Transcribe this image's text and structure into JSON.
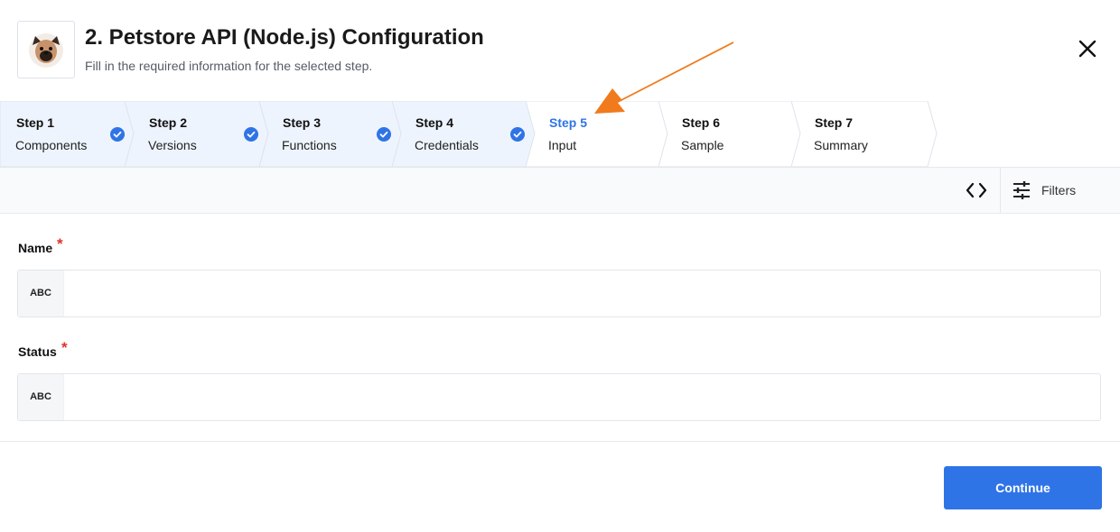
{
  "header": {
    "title": "2. Petstore API (Node.js) Configuration",
    "subtitle": "Fill in the required information for the selected step."
  },
  "steps": [
    {
      "number": "Step 1",
      "name": "Components",
      "completed": true
    },
    {
      "number": "Step 2",
      "name": "Versions",
      "completed": true
    },
    {
      "number": "Step 3",
      "name": "Functions",
      "completed": true
    },
    {
      "number": "Step 4",
      "name": "Credentials",
      "completed": true
    },
    {
      "number": "Step 5",
      "name": "Input",
      "active": true
    },
    {
      "number": "Step 6",
      "name": "Sample"
    },
    {
      "number": "Step 7",
      "name": "Summary"
    }
  ],
  "toolbar": {
    "code_icon": "code-brackets-icon",
    "filters_label": "Filters"
  },
  "form": {
    "fields": [
      {
        "label": "Name",
        "required_mark": "*",
        "type": "ABC",
        "value": ""
      },
      {
        "label": "Status",
        "required_mark": "*",
        "type": "ABC",
        "value": ""
      }
    ]
  },
  "footer": {
    "continue_label": "Continue"
  },
  "colors": {
    "accent": "#2f74e6",
    "completed_step_bg": "#eef4fd",
    "required": "#e0322e",
    "annotation_arrow": "#f07a1c"
  }
}
